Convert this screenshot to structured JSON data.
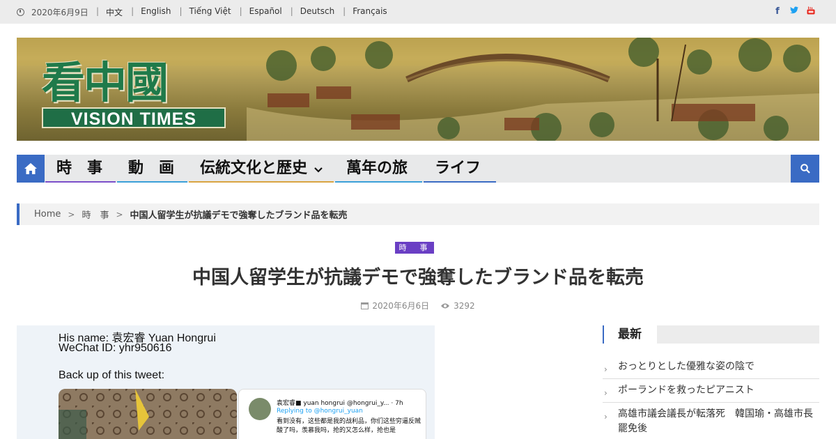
{
  "topbar": {
    "date": "2020年6月9日",
    "languages": [
      "中文",
      "English",
      "Tiếng Việt",
      "Español",
      "Deutsch",
      "Français"
    ],
    "social_icons": [
      "facebook-icon",
      "twitter-icon",
      "youtube-icon"
    ]
  },
  "banner": {
    "logo_cn": "看中國",
    "logo_en": "VISION TIMES"
  },
  "nav": {
    "items": [
      {
        "label": "時　事",
        "color": "#7b4fc9"
      },
      {
        "label": "動　画",
        "color": "#3aa0d8"
      },
      {
        "label": "伝統文化と歴史",
        "color": "#d9a441"
      },
      {
        "label": "萬年の旅",
        "color": "#3aa0d8"
      },
      {
        "label": "ライフ",
        "color": "#3a6bc4"
      }
    ],
    "accent": "#3a6bc4"
  },
  "breadcrumb": {
    "home": "Home",
    "category": "時　事",
    "current": "中国人留学生が抗議デモで強奪したブランド品を転売"
  },
  "article": {
    "category": "時　事",
    "title": "中国人留学生が抗議デモで強奪したブランド品を転売",
    "date": "2020年6月6日",
    "views": "3292",
    "image": {
      "line1": "His name: 袁宏睿 Yuan Hongrui",
      "line2": "WeChat ID: yhr950616",
      "line3": "Back up of this tweet:",
      "tweet_name": "袁宏睿■ yuan hongrui @hongrui_y... · 7h",
      "tweet_reply": "Replying to @hongrui_yuan",
      "tweet_text": "看到没有，这些都是我的战利品，你们这些穷逼反贼酸了吗，羡慕我吗，抢的又怎么样，抢也是"
    }
  },
  "sidebar": {
    "heading": "最新",
    "items": [
      "おっとりとした優雅な姿の陰で",
      "ポーランドを救ったピアニスト",
      "高雄市議会議長が転落死　韓国瑜・高雄市長罷免後"
    ]
  }
}
